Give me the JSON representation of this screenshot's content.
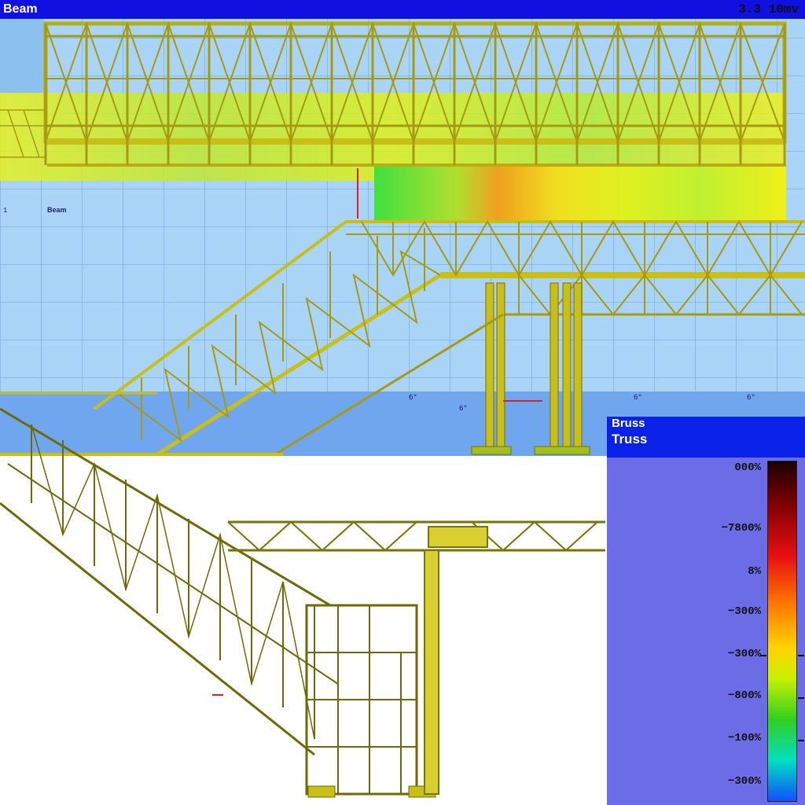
{
  "window": {
    "title_left": "Beam",
    "title_right": "3.3 10mv"
  },
  "side_labels": {
    "beam_marker": "1",
    "beam_label": "Beam"
  },
  "legend": {
    "title_line1": "Bruss",
    "title_line2": "Truss",
    "labels": [
      "000%",
      "−7800%",
      "8%",
      "−300%",
      "−300%",
      "−800%",
      "−100%",
      "−300%"
    ]
  },
  "colors": {
    "titlebar": "#1010e0",
    "grid_background": "#a9d4f5",
    "truss_member": "#c8c018",
    "legend_panel": "#6b6ce6",
    "legend_header": "#0a22e8"
  }
}
